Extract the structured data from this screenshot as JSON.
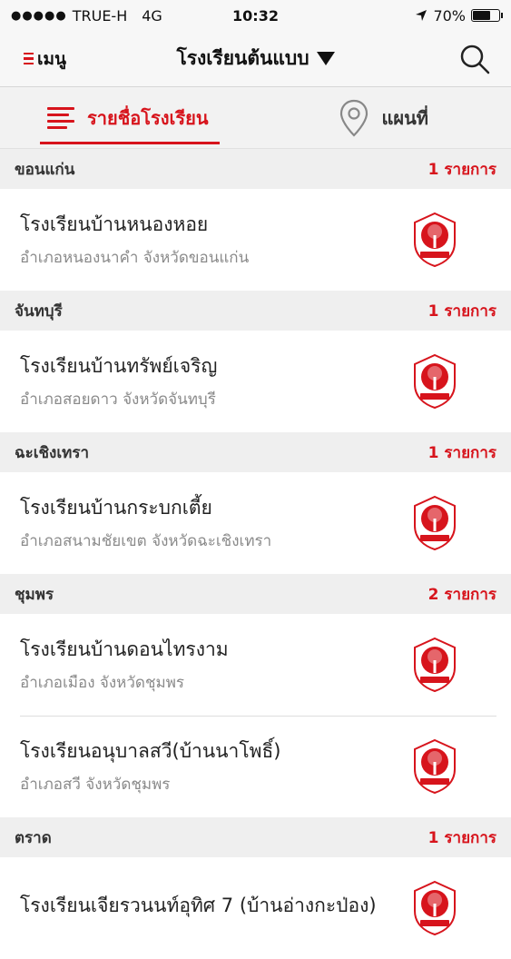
{
  "status_bar": {
    "carrier": "TRUE-H",
    "network": "4G",
    "time": "10:32",
    "battery": "70%",
    "battery_level": 0.7
  },
  "nav": {
    "menu_label": "เมนู",
    "title": "โรงเรียนต้นแบบ"
  },
  "tabs": [
    {
      "label": "รายชื่อโรงเรียน",
      "active": true
    },
    {
      "label": "แผนที่",
      "active": false
    }
  ],
  "sections": [
    {
      "name": "ขอนแก่น",
      "count": "1 รายการ",
      "schools": [
        {
          "name": "โรงเรียนบ้านหนองหอย",
          "address": "อำเภอหนองนาคำ จังหวัดขอนแก่น"
        }
      ]
    },
    {
      "name": "จันทบุรี",
      "count": "1 รายการ",
      "schools": [
        {
          "name": "โรงเรียนบ้านทรัพย์เจริญ",
          "address": "อำเภอสอยดาว จังหวัดจันทบุรี"
        }
      ]
    },
    {
      "name": "ฉะเชิงเทรา",
      "count": "1 รายการ",
      "schools": [
        {
          "name": "โรงเรียนบ้านกระบกเตี้ย",
          "address": "อำเภอสนามชัยเขต จังหวัดฉะเชิงเทรา"
        }
      ]
    },
    {
      "name": "ชุมพร",
      "count": "2 รายการ",
      "schools": [
        {
          "name": "โรงเรียนบ้านดอนไทรงาม",
          "address": "อำเภอเมือง จังหวัดชุมพร"
        },
        {
          "name": "โรงเรียนอนุบาลสวี(บ้านนาโพธิ์)",
          "address": "อำเภอสวี จังหวัดชุมพร"
        }
      ]
    },
    {
      "name": "ตราด",
      "count": "1 รายการ",
      "schools": [
        {
          "name": "โรงเรียนเจียรวนนท์อุทิศ 7 (บ้านอ่างกะป่อง)",
          "address": ""
        }
      ]
    }
  ],
  "colors": {
    "accent": "#d7141c",
    "header_bg": "#f7f7f7",
    "section_bg": "#efefef"
  },
  "icons": {
    "menu": "hamburger-icon",
    "dropdown": "caret-down-icon",
    "search": "search-icon",
    "list_tab": "list-icon",
    "map_tab": "map-pin-icon",
    "school_logo": "obec-emblem-icon"
  }
}
